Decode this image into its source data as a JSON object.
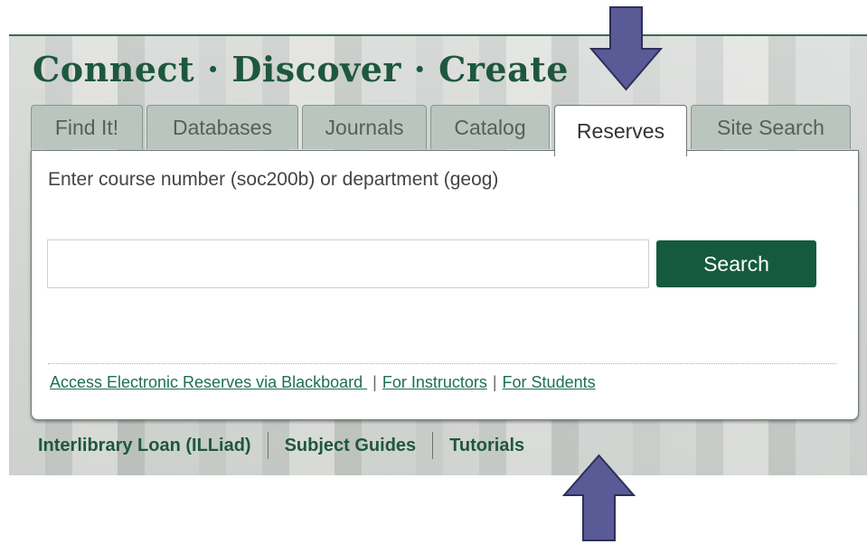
{
  "header": {
    "title": "Connect · Discover · Create"
  },
  "tabs": [
    {
      "label": "Find It!"
    },
    {
      "label": "Databases"
    },
    {
      "label": "Journals"
    },
    {
      "label": "Catalog"
    },
    {
      "label": "Reserves",
      "active": true
    },
    {
      "label": "Site Search"
    }
  ],
  "reserves": {
    "prompt": "Enter course number (soc200b) or department (geog)",
    "search_value": "",
    "search_button": "Search",
    "links": [
      {
        "label": "Access Electronic Reserves via Blackboard "
      },
      {
        "label": "For Instructors"
      },
      {
        "label": "For Students"
      }
    ],
    "separator": "|"
  },
  "bottom_nav": [
    {
      "label": "Interlibrary Loan (ILLiad)"
    },
    {
      "label": "Subject Guides"
    },
    {
      "label": "Tutorials"
    }
  ],
  "colors": {
    "brand_green": "#1e5740",
    "button_green": "#155a3f",
    "arrow": "#5a5a96"
  },
  "annotations": [
    {
      "icon": "arrow-down-icon",
      "target": "Reserves tab"
    },
    {
      "icon": "arrow-up-icon",
      "target": "Tutorials link"
    }
  ]
}
